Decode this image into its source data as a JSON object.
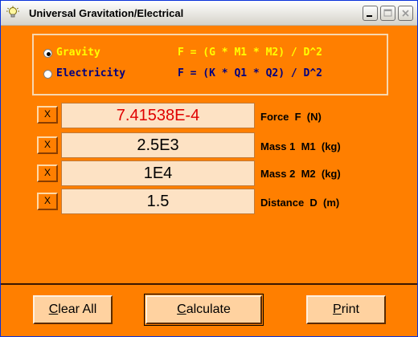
{
  "window": {
    "title": "Universal Gravitation/Electrical",
    "icon": "lightbulb-icon"
  },
  "titlebar_buttons": [
    "minimize-icon",
    "maximize-icon",
    "close-icon"
  ],
  "mode": {
    "selected": "gravity",
    "options": [
      {
        "label": "Gravity",
        "formula": "F = (G * M1 * M2) / D^2",
        "selected": true
      },
      {
        "label": "Electricity",
        "formula": "F = (K * Q1 * Q2) / D^2",
        "selected": false
      }
    ]
  },
  "fields": [
    {
      "clear_label": "X",
      "value": "7.41538E-4",
      "label": "Force  F  (N)"
    },
    {
      "clear_label": "X",
      "value": "2.5E3",
      "label": "Mass 1  M1  (kg)"
    },
    {
      "clear_label": "X",
      "value": "1E4",
      "label": "Mass 2  M2  (kg)"
    },
    {
      "clear_label": "X",
      "value": "1.5",
      "label": "Distance  D  (m)"
    }
  ],
  "buttons": {
    "clear_all": {
      "first": "C",
      "rest": "lear All"
    },
    "calculate": {
      "first": "C",
      "rest": "alculate"
    },
    "print": {
      "first": "P",
      "rest": "rint"
    }
  },
  "colors": {
    "background": "#ff7f00",
    "force_value": "#e00000",
    "gravity_text": "#ffff00",
    "electricity_text": "#000080"
  }
}
